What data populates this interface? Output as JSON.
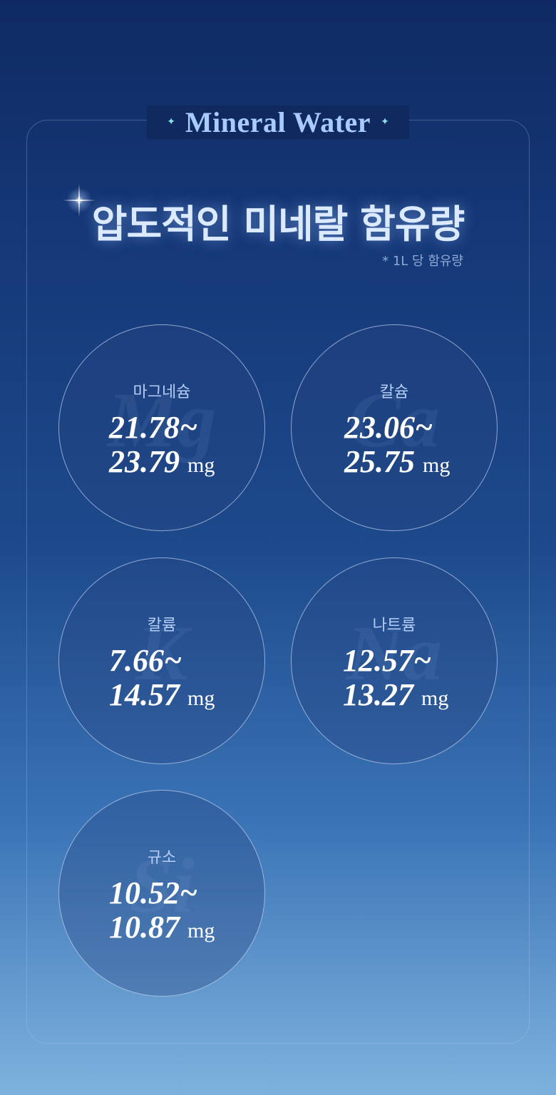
{
  "header": {
    "brand": "Mineral Water",
    "sparkle_left": "✦",
    "sparkle_right": "✦"
  },
  "title": "압도적인 미네랄 함유량",
  "note": "* 1L 당 함유량",
  "minerals": [
    {
      "name": "마그네슘",
      "symbol": "Mg",
      "from": "21.78~",
      "to": "23.79",
      "unit": "mg"
    },
    {
      "name": "칼슘",
      "symbol": "Ca",
      "from": "23.06~",
      "to": "25.75",
      "unit": "mg"
    },
    {
      "name": "칼륨",
      "symbol": "K",
      "from": "7.66~",
      "to": "14.57",
      "unit": "mg"
    },
    {
      "name": "나트륨",
      "symbol": "Na",
      "from": "12.57~",
      "to": "13.27",
      "unit": "mg"
    },
    {
      "name": "규소",
      "symbol": "Si",
      "from": "10.52~",
      "to": "10.87",
      "unit": "mg"
    }
  ],
  "colors": {
    "accent": "#a9ccff",
    "sparkle": "#8fe0e8",
    "bg_top": "#0f2a63",
    "bg_bottom": "#7eb2de"
  }
}
